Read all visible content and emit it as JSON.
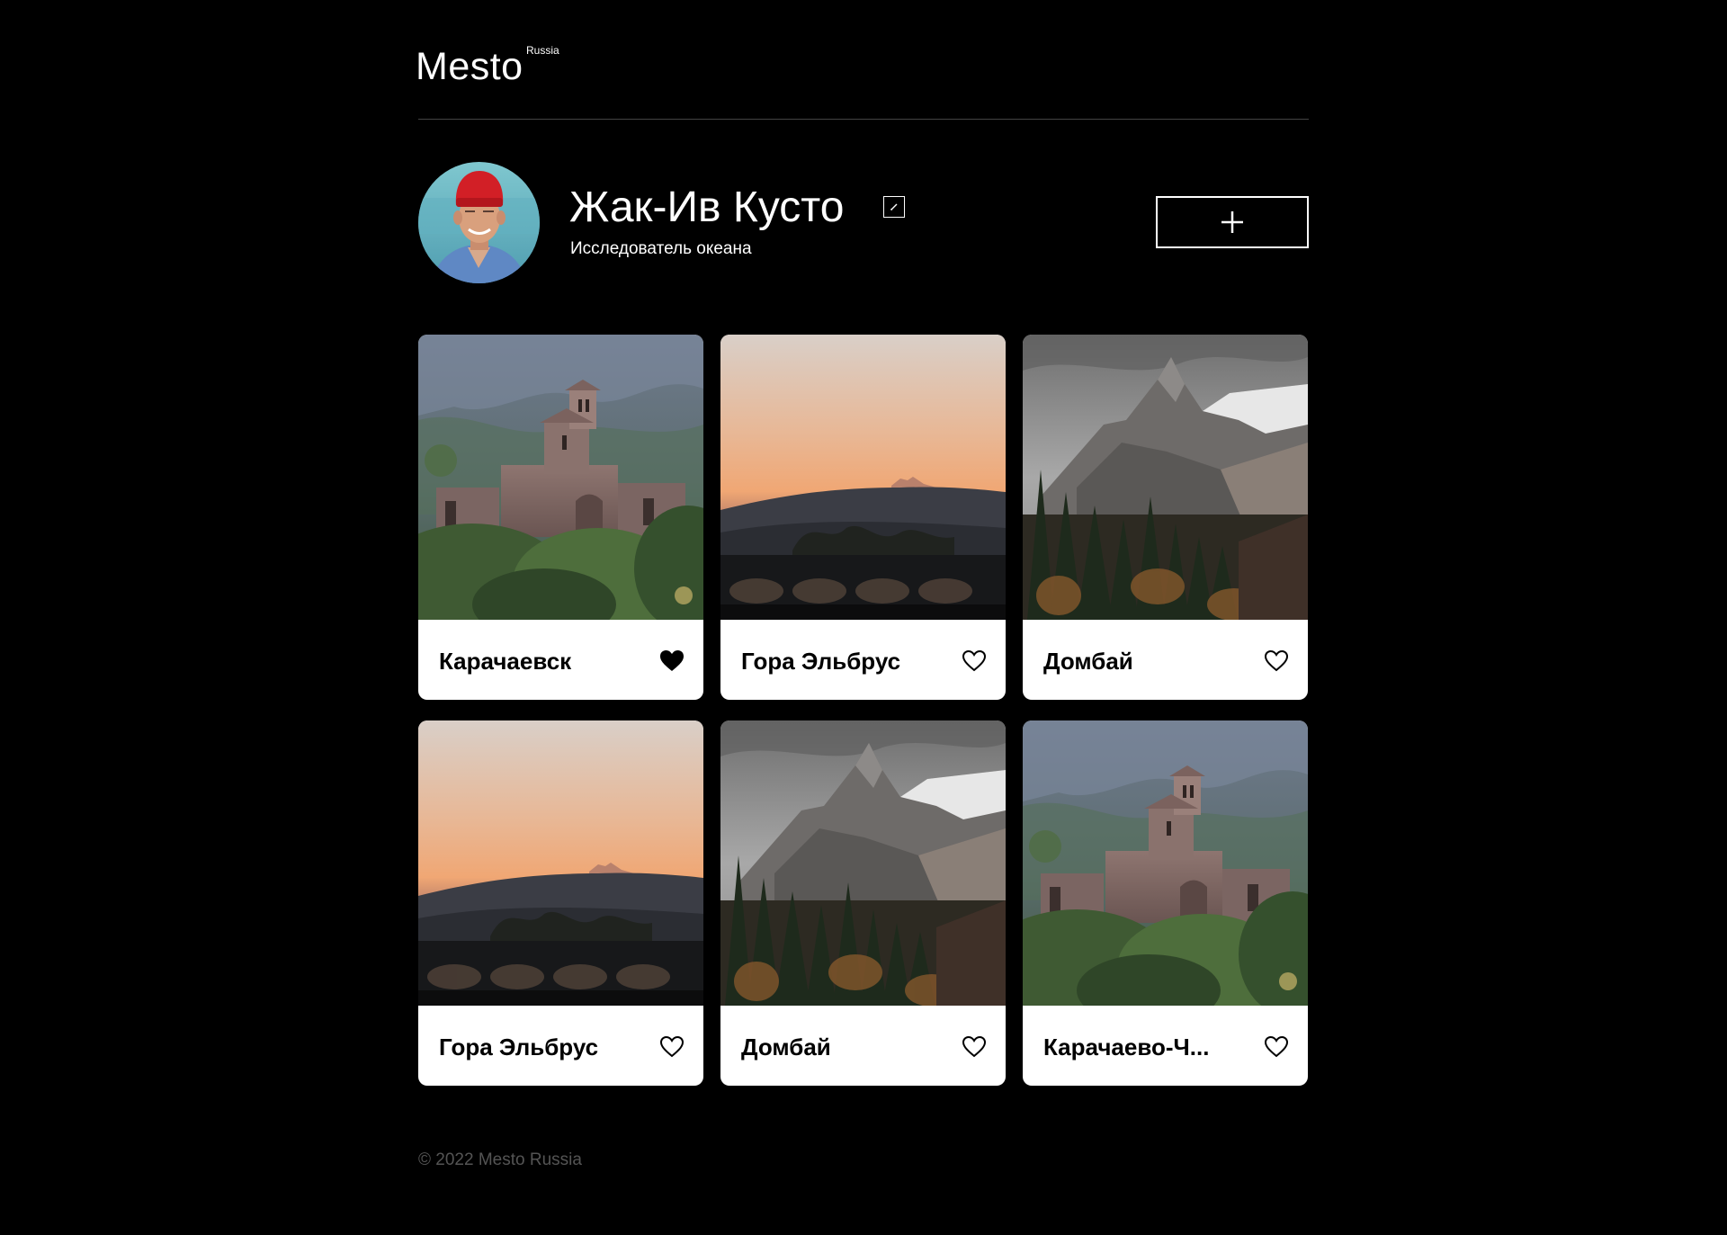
{
  "header": {
    "logo": "Mesto",
    "logo_sup": "Russia"
  },
  "profile": {
    "name": "Жак-Ив Кусто",
    "about": "Исследователь океана",
    "add_label": "+"
  },
  "cards": [
    {
      "title": "Карачаевск",
      "image": "church-ruins",
      "liked": true
    },
    {
      "title": "Гора Эльбрус",
      "image": "elbrus-sunset",
      "liked": false
    },
    {
      "title": "Домбай",
      "image": "dombay-peak",
      "liked": false
    },
    {
      "title": "Гора Эльбрус",
      "image": "elbrus-sunset",
      "liked": false
    },
    {
      "title": "Домбай",
      "image": "dombay-peak",
      "liked": false
    },
    {
      "title": "Карачаево-Ч...",
      "image": "church-ruins",
      "liked": false
    }
  ],
  "footer": {
    "copyright": "© 2022 Mesto Russia"
  },
  "colors": {
    "background": "#000000",
    "text": "#ffffff",
    "card": "#ffffff",
    "card_text": "#000000",
    "footer_text": "#545454",
    "divider": "#545454"
  }
}
